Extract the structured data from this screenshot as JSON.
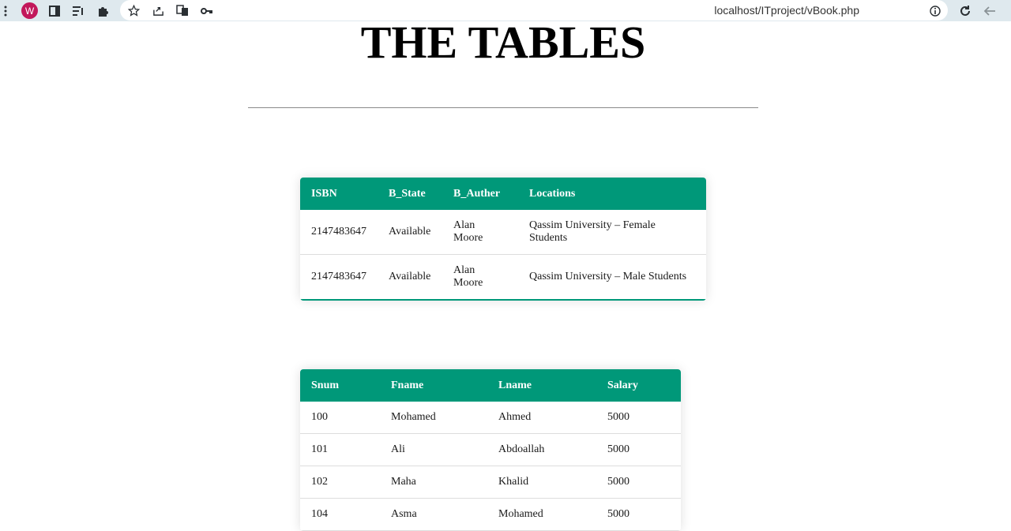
{
  "browser": {
    "profile_initial": "W",
    "url": "localhost/ITproject/vBook.php",
    "icons": [
      "menu-dots-icon",
      "profile-icon",
      "sidebar-icon",
      "reading-list-icon",
      "extensions-icon",
      "star-icon",
      "share-icon",
      "translate-icon",
      "key-icon",
      "info-icon",
      "reload-icon",
      "back-icon"
    ]
  },
  "page": {
    "title": "THE TABLES"
  },
  "books_table": {
    "headers": [
      "ISBN",
      "B_State",
      "B_Auther",
      "Locations"
    ],
    "rows": [
      [
        "2147483647",
        "Available",
        "Alan Moore",
        "Qassim University – Female Students"
      ],
      [
        "2147483647",
        "Available",
        "Alan Moore",
        "Qassim University – Male Students"
      ]
    ]
  },
  "staff_table": {
    "headers": [
      "Snum",
      "Fname",
      "Lname",
      "Salary"
    ],
    "rows": [
      [
        "100",
        "Mohamed",
        "Ahmed",
        "5000"
      ],
      [
        "101",
        "Ali",
        "Abdoallah",
        "5000"
      ],
      [
        "102",
        "Maha",
        "Khalid",
        "5000"
      ],
      [
        "104",
        "Asma",
        "Mohamed",
        "5000"
      ]
    ]
  },
  "colors": {
    "header_green": "#009879",
    "toolbar_bg": "#dfe9ee",
    "profile_pink": "#c2185b"
  }
}
